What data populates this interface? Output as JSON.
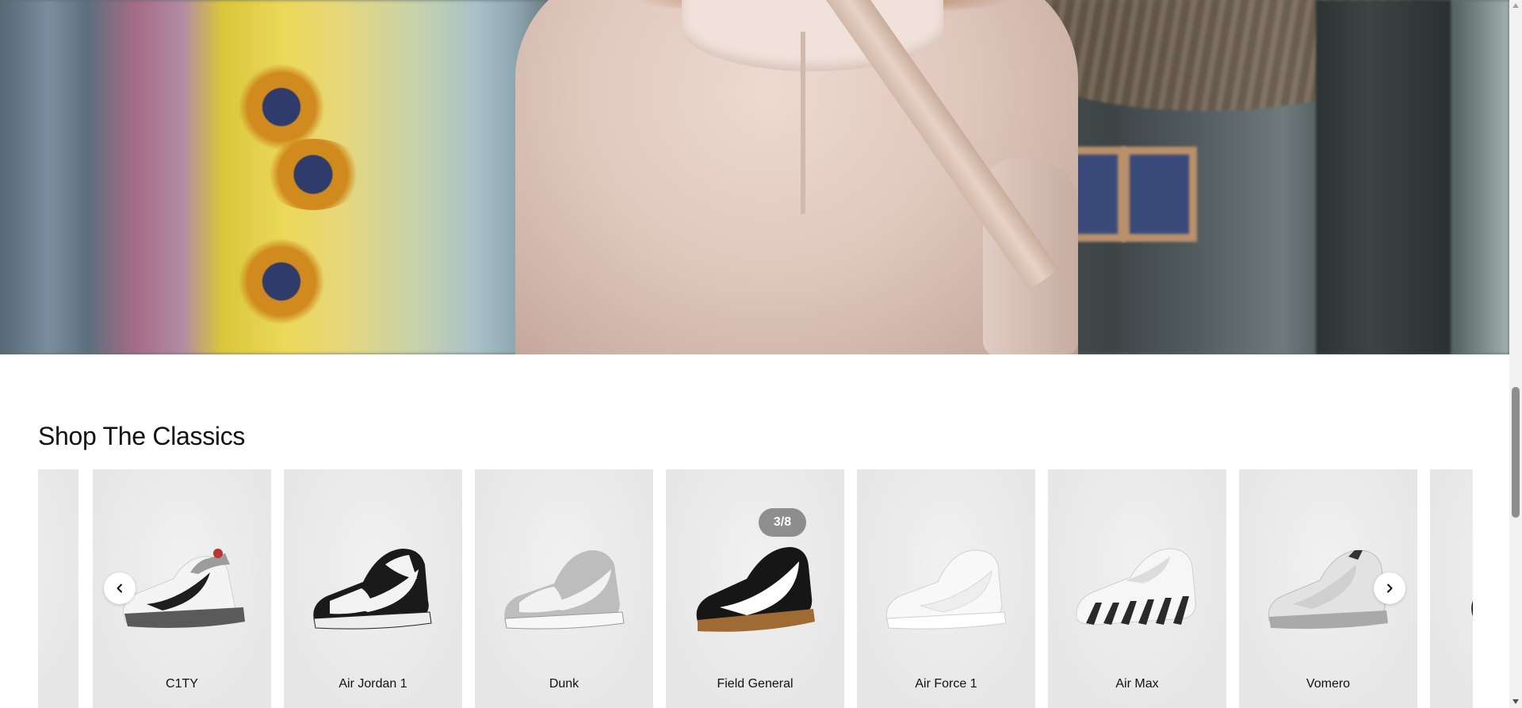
{
  "section": {
    "title": "Shop The Classics"
  },
  "carousel": {
    "counter": "3/8",
    "prev_icon": "chevron-left-icon",
    "next_icon": "chevron-right-icon",
    "items": [
      {
        "label": "C1TY"
      },
      {
        "label": "Air Jordan 1"
      },
      {
        "label": "Dunk"
      },
      {
        "label": "Field General"
      },
      {
        "label": "Air Force 1"
      },
      {
        "label": "Air Max"
      },
      {
        "label": "Vomero"
      }
    ]
  },
  "colors": {
    "card_bg": "#ebebeb",
    "text": "#111111",
    "counter_bg": "#6e6e6e"
  }
}
